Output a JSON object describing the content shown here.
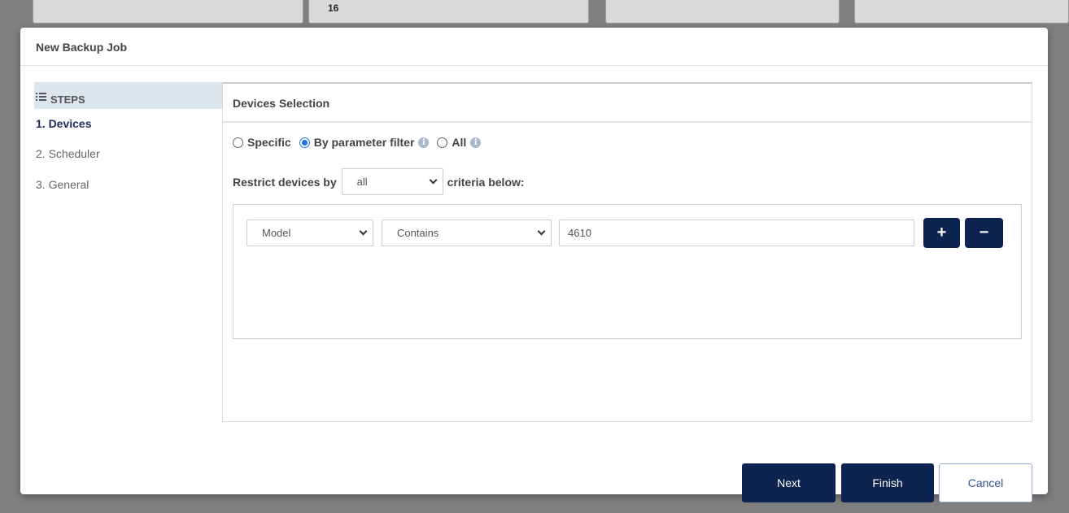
{
  "background": {
    "card_number": "16"
  },
  "modal": {
    "title": "New Backup Job",
    "steps_title": "STEPS",
    "steps": [
      "1. Devices",
      "2. Scheduler",
      "3. General"
    ],
    "panel_title": "Devices Selection",
    "radio_options": [
      {
        "label": "Specific",
        "checked": false
      },
      {
        "label": "By parameter filter",
        "checked": true
      },
      {
        "label": "All",
        "checked": false
      }
    ],
    "restrict_prefix": "Restrict devices by",
    "restrict_value": "all",
    "restrict_suffix": "criteria below:",
    "criteria": {
      "field": "Model",
      "operator": "Contains",
      "value": "4610"
    },
    "buttons": {
      "next": "Next",
      "finish": "Finish",
      "cancel": "Cancel"
    }
  },
  "colors": {
    "primary": "#0d2350",
    "radio_accent": "#1a73e8",
    "steps_header_bg": "#dde5ee"
  }
}
